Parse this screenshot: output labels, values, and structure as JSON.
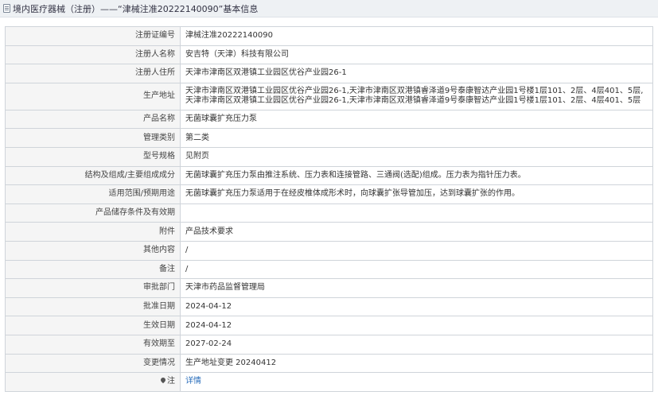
{
  "header": {
    "title": "境内医疗器械（注册）——“津械注准20222140090”基本信息"
  },
  "rows": [
    {
      "label": "注册证编号",
      "value": "津械注准20222140090"
    },
    {
      "label": "注册人名称",
      "value": "安吉特（天津）科技有限公司"
    },
    {
      "label": "注册人住所",
      "value": "天津市津南区双港镇工业园区优谷产业园26-1"
    },
    {
      "label": "生产地址",
      "value": "天津市津南区双港镇工业园区优谷产业园26-1,天津市津南区双港镇睿泽道9号泰康智达产业园1号楼1层101、2层、4层401、5层,天津市津南区双港镇工业园区优谷产业园26-1,天津市津南区双港镇睿泽道9号泰康智达产业园1号楼1层101、2层、4层401、5层"
    },
    {
      "label": "产品名称",
      "value": "无菌球囊扩充压力泵"
    },
    {
      "label": "管理类别",
      "value": "第二类"
    },
    {
      "label": "型号规格",
      "value": "见附页"
    },
    {
      "label": "结构及组成/主要组成成分",
      "value": "无菌球囊扩充压力泵由推注系统、压力表和连接管路、三通阀(选配)组成。压力表为指针压力表。"
    },
    {
      "label": "适用范围/预期用途",
      "value": "无菌球囊扩充压力泵适用于在经皮椎体成形术时，向球囊扩张导管加压，达到球囊扩张的作用。"
    },
    {
      "label": "产品储存条件及有效期",
      "value": ""
    },
    {
      "label": "附件",
      "value": "产品技术要求"
    },
    {
      "label": "其他内容",
      "value": "/"
    },
    {
      "label": "备注",
      "value": "/"
    },
    {
      "label": "审批部门",
      "value": "天津市药品监督管理局"
    },
    {
      "label": "批准日期",
      "value": "2024-04-12"
    },
    {
      "label": "生效日期",
      "value": "2024-04-12"
    },
    {
      "label": "有效期至",
      "value": "2027-02-24"
    },
    {
      "label": "变更情况",
      "value": "生产地址变更 20240412"
    }
  ],
  "note_row": {
    "label": "注",
    "link": "详情"
  }
}
